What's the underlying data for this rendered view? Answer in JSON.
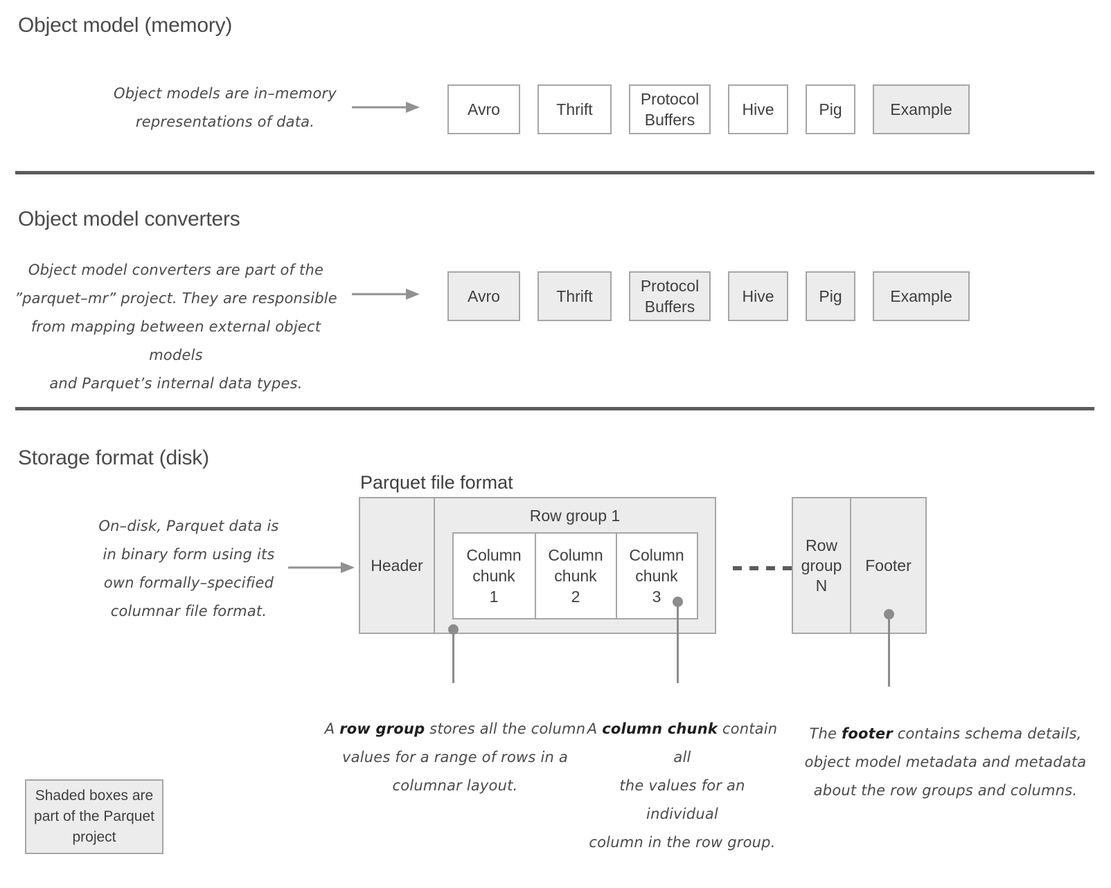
{
  "sections": {
    "object_model": {
      "title": "Object model (memory)",
      "note": "Object models are in–memory\nrepresentations of data.",
      "boxes": [
        {
          "label": "Avro",
          "shaded": false
        },
        {
          "label": "Thrift",
          "shaded": false
        },
        {
          "label": "Protocol\nBuffers",
          "shaded": false
        },
        {
          "label": "Hive",
          "shaded": false
        },
        {
          "label": "Pig",
          "shaded": false
        },
        {
          "label": "Example",
          "shaded": true
        }
      ]
    },
    "converters": {
      "title": "Object model converters",
      "note": "Object model converters are part of the\n”parquet–mr” project. They are responsible\nfrom mapping between external object models\nand Parquet’s internal data types.",
      "boxes": [
        {
          "label": "Avro",
          "shaded": true
        },
        {
          "label": "Thrift",
          "shaded": true
        },
        {
          "label": "Protocol\nBuffers",
          "shaded": true
        },
        {
          "label": "Hive",
          "shaded": true
        },
        {
          "label": "Pig",
          "shaded": true
        },
        {
          "label": "Example",
          "shaded": true
        }
      ]
    },
    "storage": {
      "title": "Storage format (disk)",
      "note": "On–disk, Parquet data is\nin binary form using its\nown formally–specified\ncolumnar file format.",
      "diagram_title": "Parquet file format",
      "header_label": "Header",
      "rowgroup1_label": "Row group 1",
      "chunks": [
        "Column\nchunk\n1",
        "Column\nchunk\n2",
        "Column\nchunk\n3"
      ],
      "rowgroupN_label": "Row\ngroup\nN",
      "footer_label": "Footer"
    }
  },
  "callouts": {
    "row_group": {
      "lead": "A ",
      "bold": "row group",
      "rest": " stores all the column\nvalues for a range of rows in a\ncolumnar layout."
    },
    "column_chunk": {
      "lead": "A ",
      "bold": "column chunk",
      "rest": " contain all\nthe values for an individual\ncolumn in the row group."
    },
    "footer": {
      "lead": "The ",
      "bold": "footer",
      "rest": " contains schema details,\nobject model metadata and metadata\nabout the row groups and columns."
    }
  },
  "legend": {
    "text": "Shaded boxes are\npart of the Parquet\nproject"
  },
  "colors": {
    "shade": "#ececec",
    "box_border": "#a6a6a6",
    "divider": "#5c5c5c",
    "text": "#4a4a4a",
    "leader": "#8c8c8c"
  }
}
